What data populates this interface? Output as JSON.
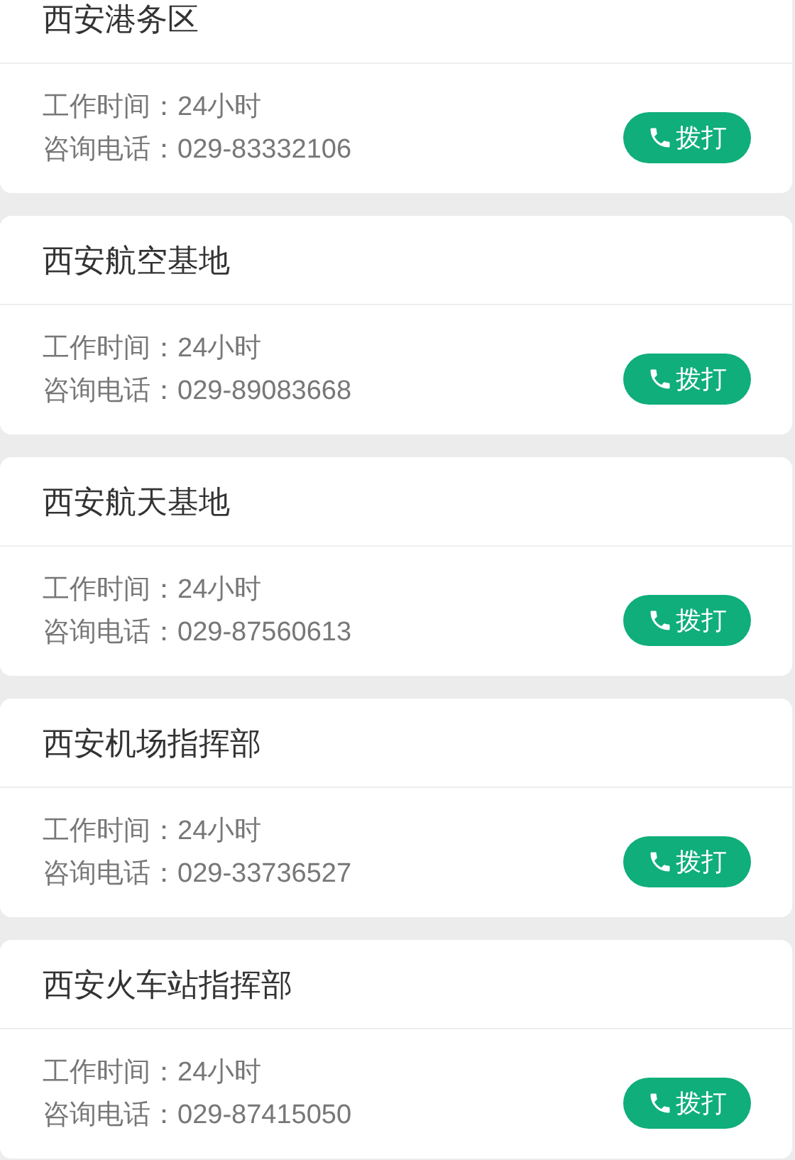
{
  "offices": [
    {
      "name": "西安港务区",
      "hours": "工作时间：24小时",
      "phone": "咨询电话：029-83332106",
      "call_button": "拨打"
    },
    {
      "name": "西安航空基地",
      "hours": "工作时间：24小时",
      "phone": "咨询电话：029-89083668",
      "call_button": "拨打"
    },
    {
      "name": "西安航天基地",
      "hours": "工作时间：24小时",
      "phone": "咨询电话：029-87560613",
      "call_button": "拨打"
    },
    {
      "name": "西安机场指挥部",
      "hours": "工作时间：24小时",
      "phone": "咨询电话：029-33736527",
      "call_button": "拨打"
    },
    {
      "name": "西安火车站指挥部",
      "hours": "工作时间：24小时",
      "phone": "咨询电话：029-87415050",
      "call_button": "拨打"
    }
  ]
}
